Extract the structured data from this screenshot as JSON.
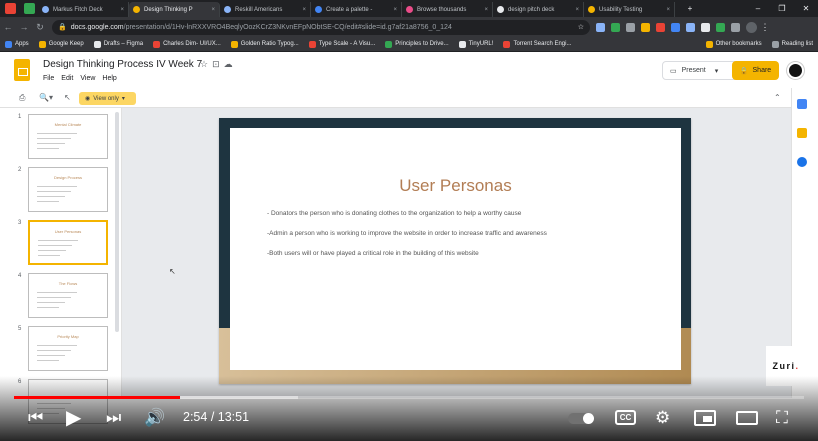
{
  "browser": {
    "tabs": [
      {
        "label": "Markus Fitch Deck",
        "active": false,
        "color": "#8ab4f8"
      },
      {
        "label": "Design Thinking P",
        "active": true,
        "color": "#f4b400"
      },
      {
        "label": "Reskill Americans",
        "active": false,
        "color": "#8ab4f8"
      },
      {
        "label": "Create a palette -",
        "active": false,
        "color": "#4285f4"
      },
      {
        "label": "Browse thousands",
        "active": false,
        "color": "#ea4c89"
      },
      {
        "label": "design pitch deck",
        "active": false,
        "color": "#e8eaed"
      },
      {
        "label": "Usability Testing",
        "active": false,
        "color": "#f4b400"
      }
    ],
    "new_tab": "+",
    "url_host": "docs.google.com",
    "url_path": "/presentation/d/1Hv-lnRXXVRO4BeqlyOozKCrZ3NKvnEFpNObtSE-CQ/edit#slide=id.g7af21a8756_0_124",
    "bookmarks": [
      {
        "label": "Apps",
        "color": "#4285f4"
      },
      {
        "label": "Google Keep",
        "color": "#f4b400"
      },
      {
        "label": "Drafts – Figma",
        "color": "#e8eaed"
      },
      {
        "label": "Charles Dim- UI/UX...",
        "color": "#ea4335"
      },
      {
        "label": "Golden Ratio Typog...",
        "color": "#f4b400"
      },
      {
        "label": "Type Scale - A Visu...",
        "color": "#ea4335"
      },
      {
        "label": "Principles to Drive...",
        "color": "#34a853"
      },
      {
        "label": "TinyURL!",
        "color": "#e8eaed"
      },
      {
        "label": "Torrent Search Engi...",
        "color": "#ea4335"
      }
    ],
    "other_bookmarks": "Other bookmarks",
    "reading_list": "Reading list"
  },
  "doc": {
    "title": "Design Thinking Process IV Week 7",
    "menu": [
      "File",
      "Edit",
      "View",
      "Help"
    ],
    "present_label": "Present",
    "share_label": "Share",
    "view_only_label": "View only",
    "accent": "#f4b400"
  },
  "filmstrip": {
    "thumbs": [
      {
        "num": "1",
        "title": "Mental Climate"
      },
      {
        "num": "2",
        "title": "Design Process"
      },
      {
        "num": "3",
        "title": "User Personas"
      },
      {
        "num": "4",
        "title": "The Flows"
      },
      {
        "num": "5",
        "title": "Priority Map"
      },
      {
        "num": "6",
        "title": ""
      }
    ],
    "selected_index": 2
  },
  "slide": {
    "title": "User Personas",
    "bullets": [
      "- Donators the person who is donating clothes to the organization to help a worthy cause",
      "-Admin a person who is working to improve the website in order to increase traffic and awareness",
      "-Both users will or have played a critical role in the building of this website"
    ],
    "colors": {
      "title": "#b27d54",
      "dark": "#1e3440",
      "gold": "#b08a52"
    }
  },
  "watermark": {
    "brand": "Zuri",
    "dot": "."
  },
  "player": {
    "current_time": "2:54",
    "separator": " / ",
    "duration": "13:51",
    "progress_fraction": 0.21,
    "buffer_fraction": 0.36,
    "cc_label": "CC",
    "icons": [
      "previous-icon",
      "play-icon",
      "next-icon",
      "volume-icon",
      "autoplay-toggle",
      "cc-icon",
      "settings-icon",
      "miniplayer-icon",
      "theater-icon",
      "fullscreen-icon"
    ]
  }
}
